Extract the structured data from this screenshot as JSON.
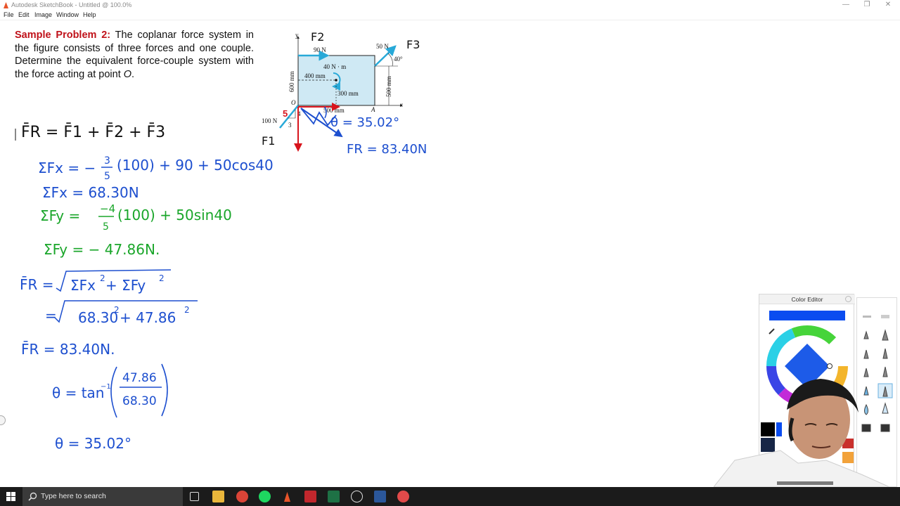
{
  "window": {
    "title": "Autodesk SketchBook - Untitled @ 100.0%"
  },
  "menu": {
    "items": [
      "File",
      "Edit",
      "Image",
      "Window",
      "Help"
    ]
  },
  "problem": {
    "lead": "Sample Problem 2:",
    "body_1": " The coplanar force system in the figure consists of three forces and one couple. Determine the equivalent force-couple system with the force acting at point ",
    "point": "O",
    "body_2": "."
  },
  "figure": {
    "axis_y": "y",
    "axis_x": "x",
    "force_90": "90 N",
    "force_50": "50 N",
    "angle_40": "40°",
    "couple": "40 N · m",
    "dim_400": "400 mm",
    "dim_300": "300 mm",
    "dim_500v": "500 mm",
    "dim_600": "600 mm",
    "dim_500h": "500 mm",
    "point_o": "O",
    "point_a": "A",
    "force_100": "100 N",
    "slope_3": "3",
    "slope_4": "4",
    "slope_5": "5"
  },
  "annotations": {
    "f1": "F1",
    "f2": "F2",
    "f3": "F3",
    "theta_fig": "θ = 35.02°",
    "fr_fig": "FR = 83.40N"
  },
  "work": {
    "line1": "F̄R = F̄1 + F̄2 + F̄3",
    "line2a": "ΣFx = −",
    "line2frac_num": "3",
    "line2frac_den": "5",
    "line2b": "(100) + 90 + 50cos40",
    "line3": "ΣFx = 68.30N",
    "line4a": "ΣFy = ",
    "line4frac_num": "−4",
    "line4frac_den": "5",
    "line4b": "(100) + 50sin40",
    "line5": "ΣFy = − 47.86N.",
    "line6a": "F̄R = ",
    "line6b": "ΣFx",
    "line6c": "2",
    "line6d": " + ΣFy",
    "line6e": "2",
    "line7a": "= ",
    "line7b": "68.30",
    "line7c": "2",
    "line7d": " + 47.86",
    "line7e": "2",
    "line8": "F̄R = 83.40N.",
    "line9a": "θ = tan",
    "line9sup": "−1",
    "line9num": "47.86",
    "line9den": "68.30",
    "line10": "θ = 35.02°"
  },
  "color_editor": {
    "title": "Color Editor",
    "current_color": "#0a4cf0"
  },
  "taskbar": {
    "search_placeholder": "Type here to search"
  },
  "colors": {
    "ink_blue": "#1d4fcf",
    "ink_green": "#1aa62a",
    "ink_red": "#d8141c",
    "ink_black": "#111111",
    "figure_fill": "#cfe9f4",
    "arrow_cyan": "#28a9d8"
  }
}
